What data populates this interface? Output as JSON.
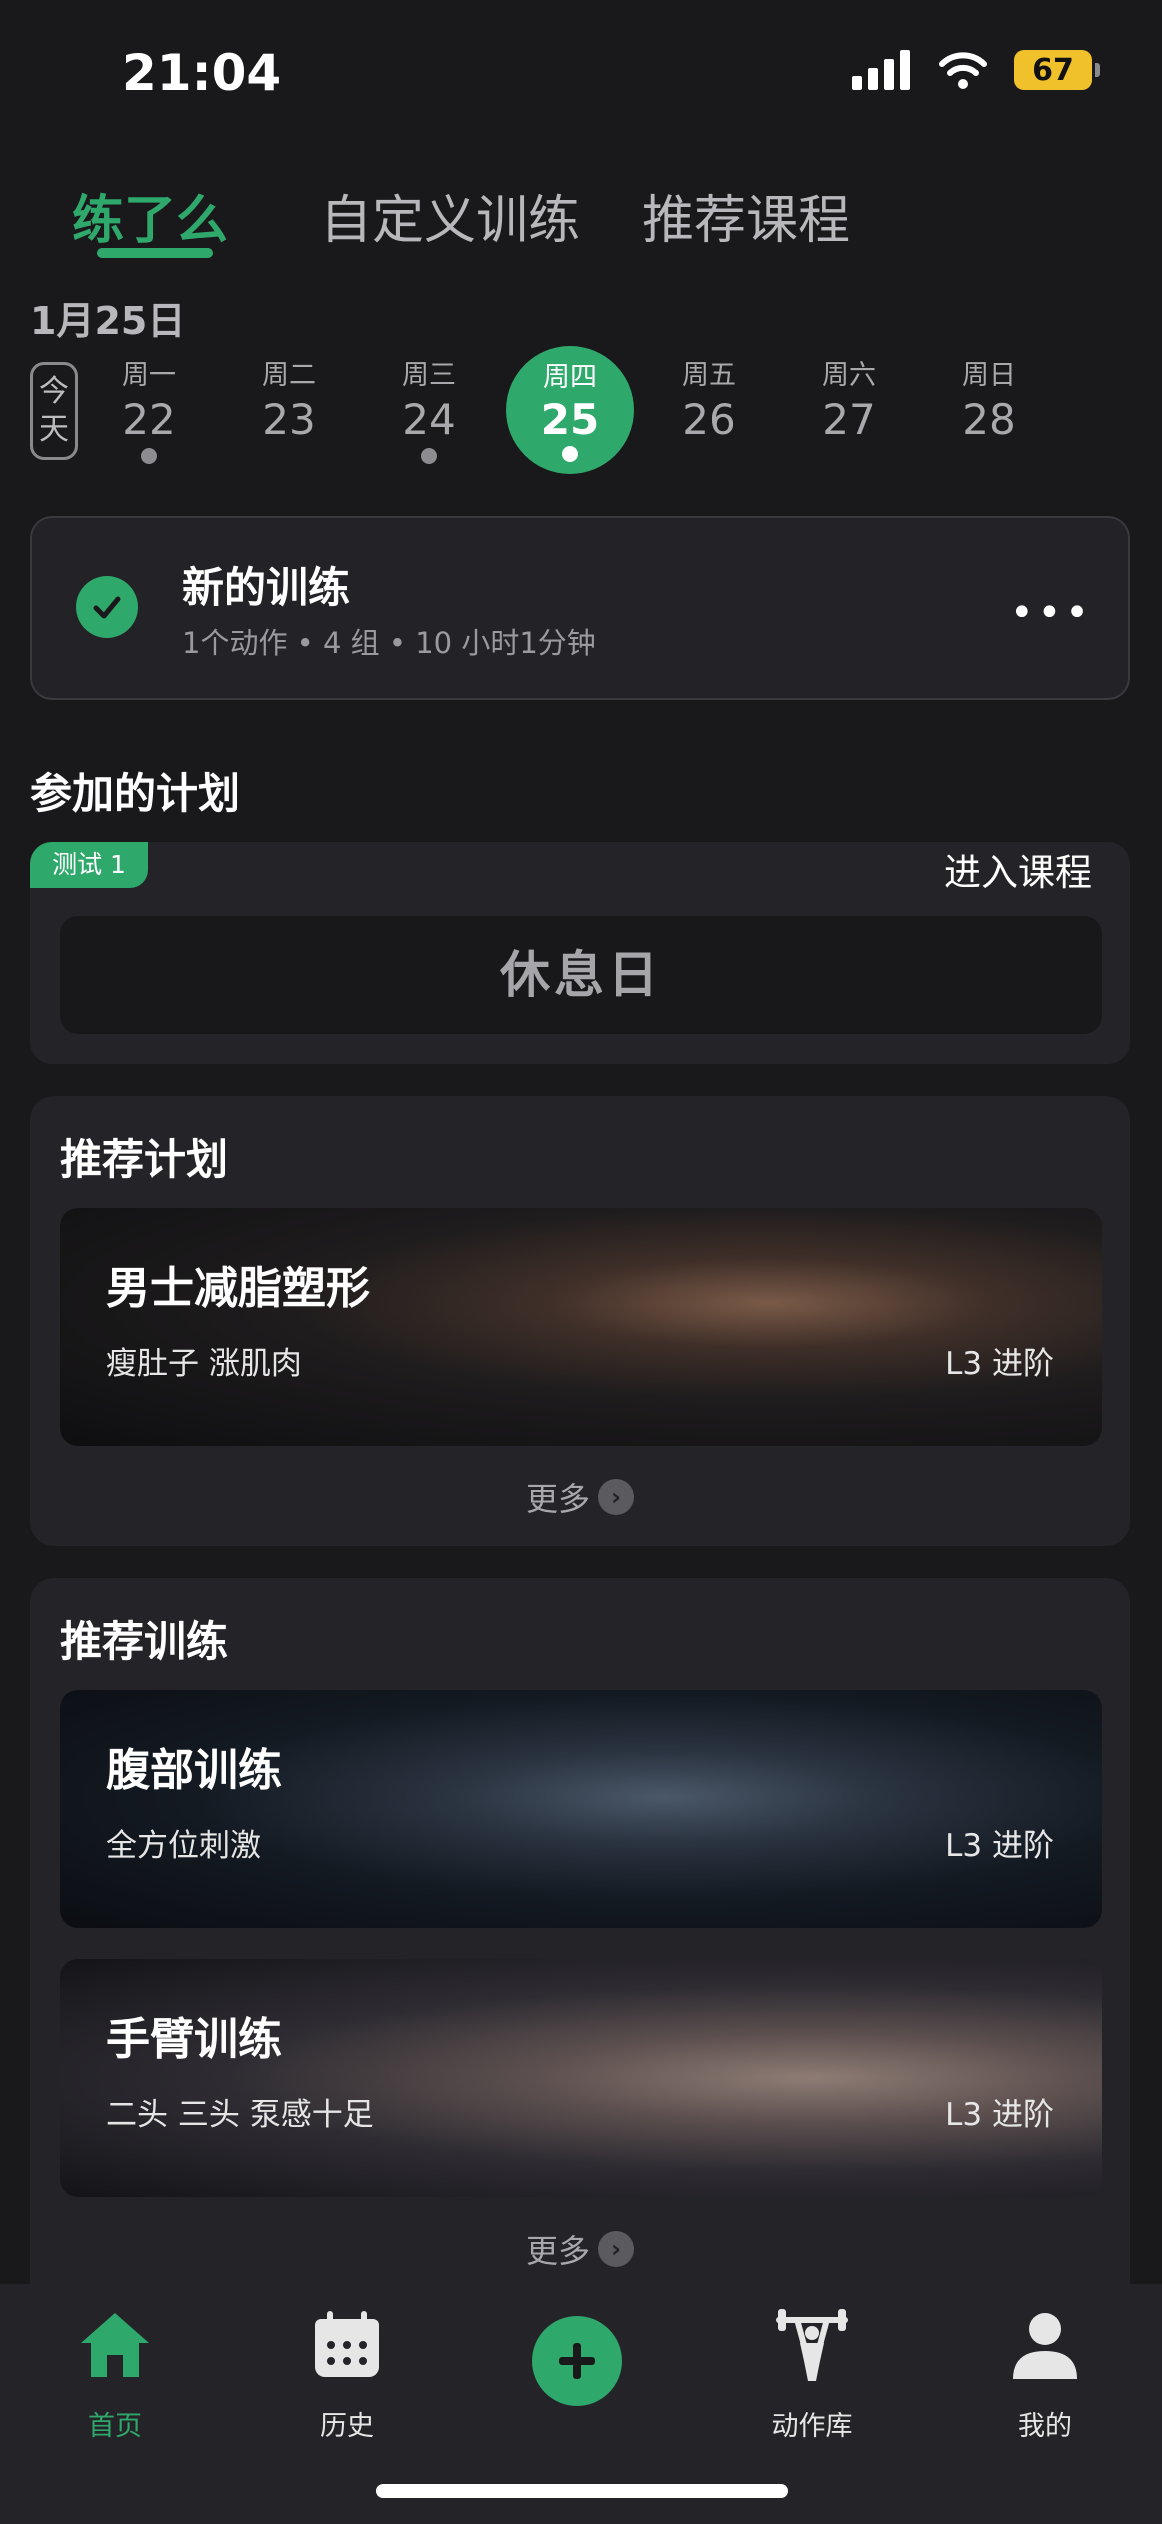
{
  "status_bar": {
    "time": "21:04",
    "battery": "67"
  },
  "top_tabs": [
    "练了么",
    "自定义训练",
    "推荐课程"
  ],
  "date_title": "1月25日",
  "today_label": "今天",
  "week": [
    {
      "weekday": "周一",
      "day": "22",
      "has_dot": true
    },
    {
      "weekday": "周二",
      "day": "23",
      "has_dot": false
    },
    {
      "weekday": "周三",
      "day": "24",
      "has_dot": true
    },
    {
      "weekday": "周四",
      "day": "25",
      "has_dot": true,
      "selected": true
    },
    {
      "weekday": "周五",
      "day": "26",
      "has_dot": false
    },
    {
      "weekday": "周六",
      "day": "27",
      "has_dot": false
    },
    {
      "weekday": "周日",
      "day": "28",
      "has_dot": false
    }
  ],
  "workout": {
    "title": "新的训练",
    "summary": "1个动作 • 4 组 • 10 小时1分钟",
    "more": "•••"
  },
  "joined_plans": {
    "section_title": "参加的计划",
    "tag": "测试 1",
    "enter_label": "进入课程",
    "rest_label": "休息日"
  },
  "recommended_plans": {
    "section_title": "推荐计划",
    "items": [
      {
        "title": "男士减脂塑形",
        "tags": "瘦肚子  涨肌肉",
        "level": "L3 进阶"
      }
    ],
    "more_label": "更多"
  },
  "recommended_training": {
    "section_title": "推荐训练",
    "items": [
      {
        "title": "腹部训练",
        "tags": "全方位刺激",
        "level": "L3 进阶"
      },
      {
        "title": "手臂训练",
        "tags": "二头 三头 泵感十足",
        "level": "L3 进阶"
      }
    ],
    "more_label": "更多"
  },
  "bottom_nav": [
    {
      "label": "首页",
      "icon": "home-icon",
      "active": true
    },
    {
      "label": "历史",
      "icon": "calendar-icon"
    },
    {
      "label": "",
      "icon": "plus-icon"
    },
    {
      "label": "动作库",
      "icon": "barbell-icon"
    },
    {
      "label": "我的",
      "icon": "user-icon"
    }
  ],
  "colors": {
    "accent": "#2fa86c",
    "background": "#19191c",
    "card": "#242428",
    "battery": "#f0c12b"
  }
}
